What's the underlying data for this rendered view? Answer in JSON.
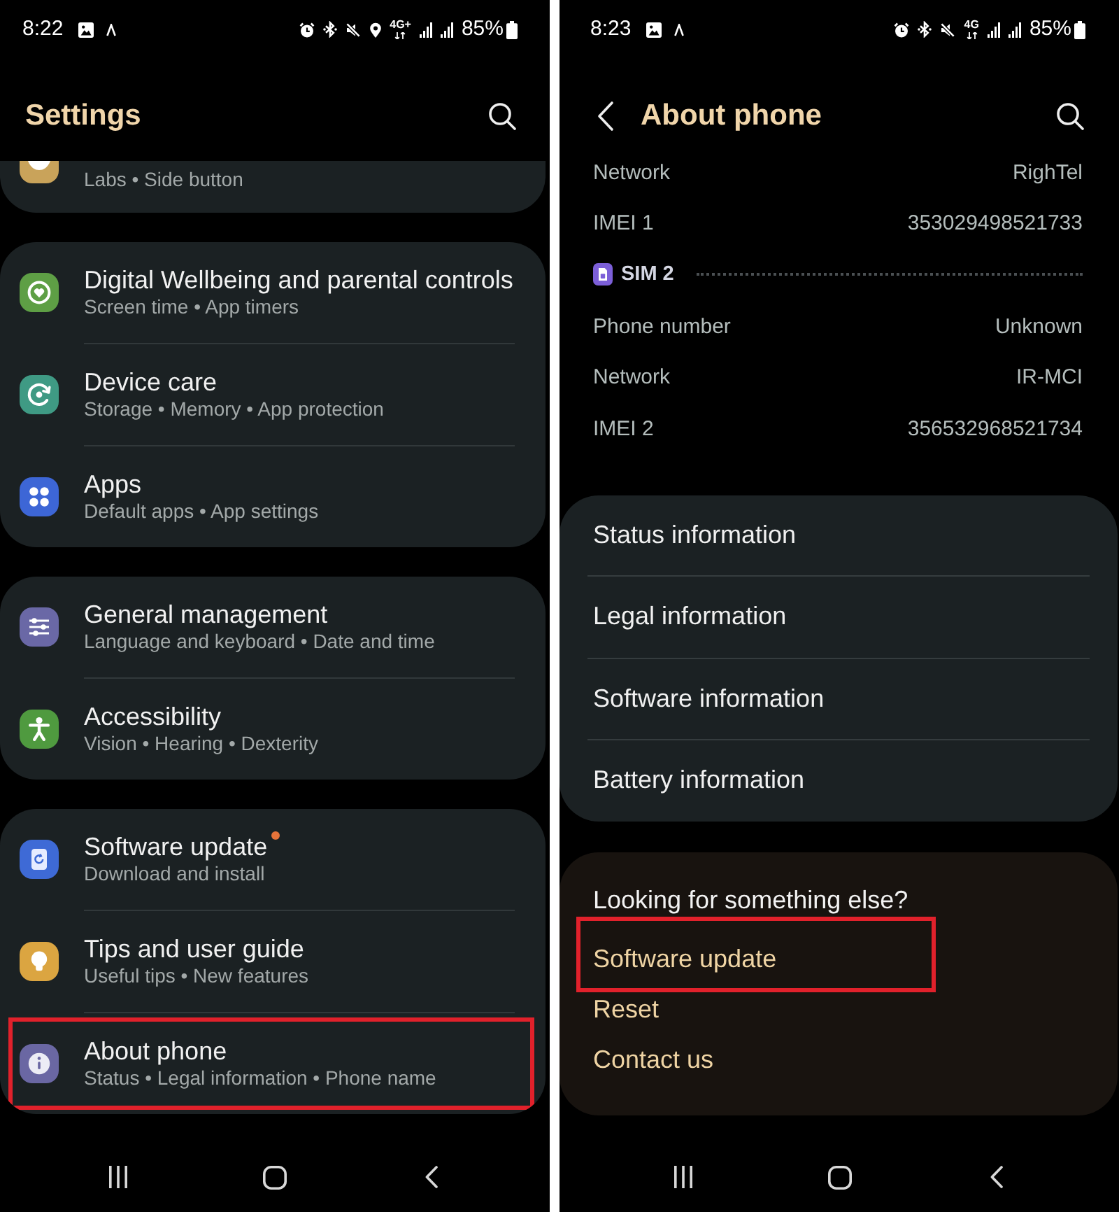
{
  "screens": [
    {
      "kind": "settings",
      "status_bar": {
        "time": "8:22",
        "location": true,
        "network_type": "4G+",
        "battery": "85%"
      },
      "header": {
        "back": false,
        "title": "Settings"
      },
      "groups": [
        {
          "cut_off": true,
          "items": [
            {
              "subtitle": "Labs • Side button",
              "color": "#c9a35a",
              "dot": false,
              "highlighted": false
            }
          ]
        },
        {
          "cut_off": false,
          "items": [
            {
              "title": "Digital Wellbeing and parental controls",
              "subtitle": "Screen time • App timers",
              "color": "#5e9f45",
              "dot": false,
              "highlighted": false
            },
            {
              "title": "Device care",
              "subtitle": "Storage • Memory • App protection",
              "color": "#3f9a84",
              "dot": false,
              "highlighted": false
            },
            {
              "title": "Apps",
              "subtitle": "Default apps • App settings",
              "color": "#3d66d6",
              "dot": false,
              "highlighted": false
            }
          ]
        },
        {
          "cut_off": false,
          "items": [
            {
              "title": "General management",
              "subtitle": "Language and keyboard • Date and time",
              "color": "#6a68a6",
              "dot": false,
              "highlighted": false
            },
            {
              "title": "Accessibility",
              "subtitle": "Vision • Hearing • Dexterity",
              "color": "#4f9a3f",
              "dot": false,
              "highlighted": false
            }
          ]
        },
        {
          "cut_off": false,
          "items": [
            {
              "title": "Software update",
              "subtitle": "Download and install",
              "color": "#3e6ad6",
              "dot": true,
              "highlighted": false
            },
            {
              "title": "Tips and user guide",
              "subtitle": "Useful tips • New features",
              "color": "#dba541",
              "dot": false,
              "highlighted": false
            },
            {
              "title": "About phone",
              "subtitle": "Status • Legal information • Phone name",
              "color": "#6a67a3",
              "dot": false,
              "highlighted": true
            }
          ]
        }
      ]
    },
    {
      "kind": "about",
      "status_bar": {
        "time": "8:23",
        "location": false,
        "network_type": "4G",
        "battery": "85%"
      },
      "header": {
        "back": true,
        "title": "About phone"
      },
      "info_rows": [
        {
          "kind": "row",
          "label": "Network",
          "value": "RighTel"
        },
        {
          "kind": "row",
          "label": "IMEI 1",
          "value": "353029498521733"
        },
        {
          "kind": "sim_header",
          "label": "SIM 2"
        },
        {
          "kind": "row",
          "label": "Phone number",
          "value": "Unknown"
        },
        {
          "kind": "row",
          "label": "Network",
          "value": "IR-MCI"
        },
        {
          "kind": "row",
          "label": "IMEI 2",
          "value": "356532968521734"
        }
      ],
      "menu": [
        {
          "label": "Status information"
        },
        {
          "label": "Legal information"
        },
        {
          "label": "Software information"
        },
        {
          "label": "Battery information"
        }
      ],
      "suggestions": {
        "title": "Looking for something else?",
        "links": [
          {
            "label": "Software update",
            "highlighted": true
          },
          {
            "label": "Reset",
            "highlighted": false
          },
          {
            "label": "Contact us",
            "highlighted": false
          }
        ]
      }
    }
  ]
}
